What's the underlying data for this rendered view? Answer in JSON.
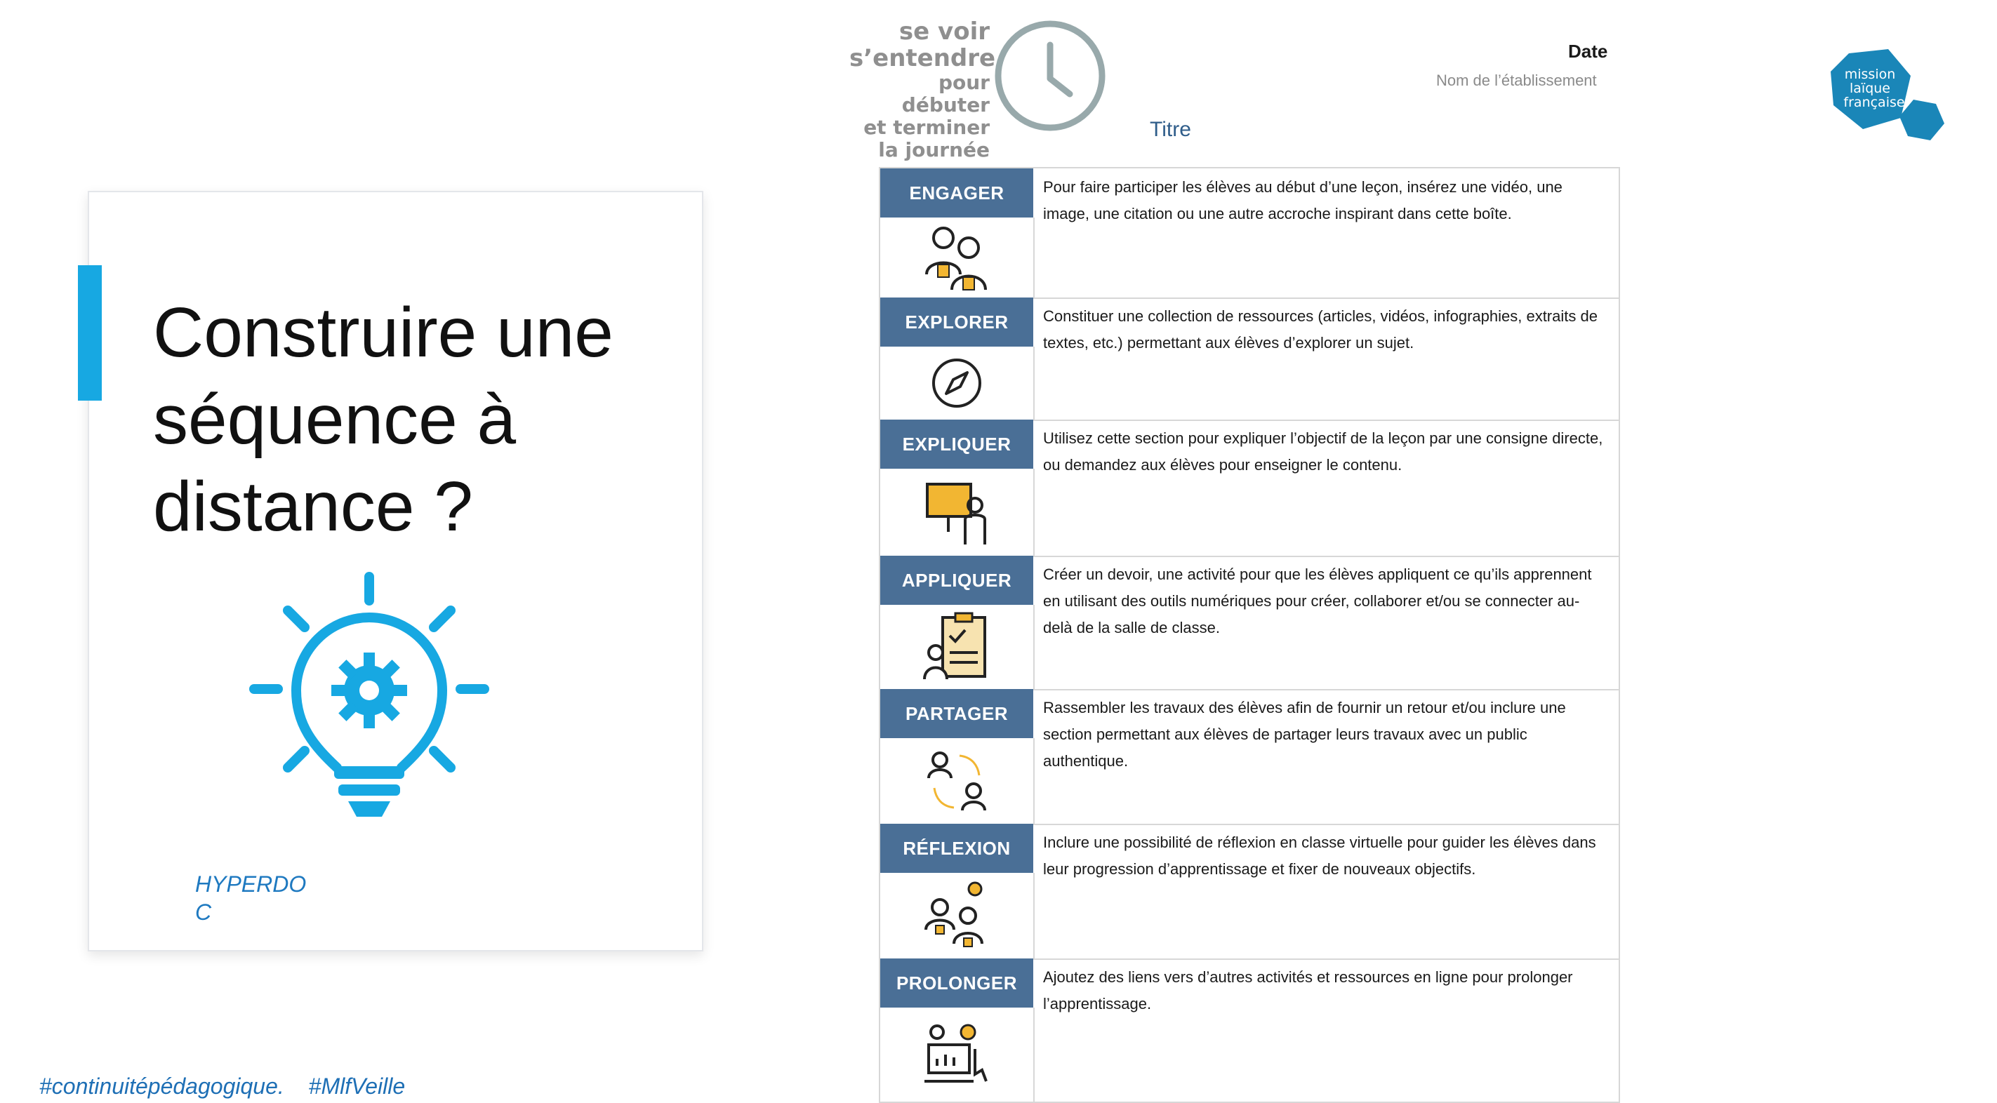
{
  "slide": {
    "title": "Construire une\nséquence à\ndistance ?",
    "caption": "HYPERDO\nC",
    "hashtags": [
      "#continuitépédagogique.",
      "#MlfVeille"
    ],
    "accent_color": "#17a8e2",
    "icon": "lightbulb-gear-icon"
  },
  "document": {
    "slogan": {
      "line1": "se voir",
      "line2": "s’entendre",
      "line3": "pour débuter",
      "line4": "et terminer",
      "line5": "la journée"
    },
    "clock_icon": "clock-icon",
    "title": "Titre",
    "date_label": "Date",
    "school_label": "Nom de l’établissement",
    "header_color": "#4a6f96",
    "rows": [
      {
        "label": "ENGAGER",
        "icon": "students-icon",
        "text": "Pour faire participer les élèves au début d’une leçon, insérez une vidéo, une image, une citation ou une autre accroche inspirant dans cette boîte."
      },
      {
        "label": "EXPLORER",
        "icon": "compass-icon",
        "text": "Constituer une collection de ressources (articles, vidéos, infographies, extraits de textes, etc.) permettant aux élèves d’explorer un sujet."
      },
      {
        "label": "EXPLIQUER",
        "icon": "presentation-board-icon",
        "text": "Utilisez cette section pour expliquer l’objectif de la leçon par une consigne directe, ou demandez aux élèves pour enseigner le contenu."
      },
      {
        "label": "APPLIQUER",
        "icon": "clipboard-checklist-icon",
        "text": "Créer un devoir, une activité pour que les élèves appliquent ce qu’ils apprennent en utilisant des outils numériques pour créer, collaborer et/ou se connecter au-delà de la salle de classe."
      },
      {
        "label": "PARTAGER",
        "icon": "exchange-people-icon",
        "text": "Rassembler les travaux des élèves afin de fournir un retour et/ou inclure une section permettant aux élèves de partager leurs travaux avec un public authentique."
      },
      {
        "label": "RÉFLEXION",
        "icon": "group-idea-icon",
        "text": "Inclure une possibilité de réflexion en classe virtuelle pour guider les élèves dans leur progression d’apprentissage et fixer de nouveaux objectifs."
      },
      {
        "label": "PROLONGER",
        "icon": "online-resources-icon",
        "text": "Ajoutez des liens vers d’autres activités et ressources en ligne pour prolonger l’apprentissage."
      }
    ]
  },
  "logo": {
    "text": "mission laïque française",
    "color": "#1a86b8"
  }
}
